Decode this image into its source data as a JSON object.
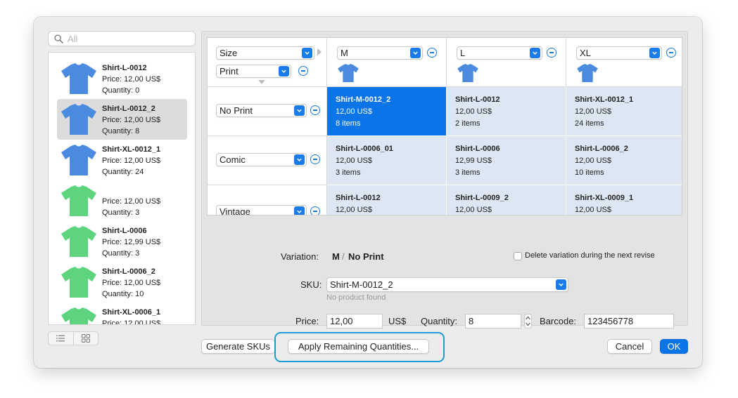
{
  "search": {
    "placeholder": "All"
  },
  "products": [
    {
      "name": "Shirt-L-0012",
      "price": "Price: 12,00 US$",
      "quantity": "Quantity: 0",
      "color": "#4a8be0"
    },
    {
      "name": "Shirt-L-0012_2",
      "price": "Price: 12,00 US$",
      "quantity": "Quantity: 8",
      "color": "#4a8be0",
      "selected": true
    },
    {
      "name": "Shirt-XL-0012_1",
      "price": "Price: 12,00 US$",
      "quantity": "Quantity: 24",
      "color": "#4a8be0"
    },
    {
      "name": "",
      "price": "Price: 12,00 US$",
      "quantity": "Quantity: 3",
      "color": "#5ed47e"
    },
    {
      "name": "Shirt-L-0006",
      "price": "Price: 12,99 US$",
      "quantity": "Quantity: 3",
      "color": "#5ed47e"
    },
    {
      "name": "Shirt-L-0006_2",
      "price": "Price: 12,00 US$",
      "quantity": "Quantity: 10",
      "color": "#5ed47e"
    },
    {
      "name": "Shirt-XL-0006_1",
      "price": "Price: 12,00 US$",
      "quantity": "",
      "color": "#5ed47e"
    }
  ],
  "grid": {
    "row_attribute": "Size",
    "col_attribute": "Print",
    "columns": [
      "M",
      "L",
      "XL"
    ],
    "rows": [
      "No Print",
      "Comic",
      "Vintage"
    ],
    "cells": [
      [
        {
          "sku": "Shirt-M-0012_2",
          "price": "12,00 US$",
          "items": "8 items",
          "active": true
        },
        {
          "sku": "Shirt-L-0012",
          "price": "12,00 US$",
          "items": "2 items"
        },
        {
          "sku": "Shirt-XL-0012_1",
          "price": "12,00 US$",
          "items": "24 items"
        }
      ],
      [
        {
          "sku": "Shirt-L-0006_01",
          "price": "12,00 US$",
          "items": "3 items"
        },
        {
          "sku": "Shirt-L-0006",
          "price": "12,99 US$",
          "items": "3 items"
        },
        {
          "sku": "Shirt-L-0006_2",
          "price": "12,00 US$",
          "items": "10 items"
        }
      ],
      [
        {
          "sku": "Shirt-L-0012",
          "price": "12,00 US$",
          "items": ""
        },
        {
          "sku": "Shirt-L-0009_2",
          "price": "12,00 US$",
          "items": ""
        },
        {
          "sku": "Shirt-XL-0009_1",
          "price": "12,00 US$",
          "items": ""
        }
      ]
    ]
  },
  "details": {
    "variation_label": "Variation:",
    "variation_size": "M",
    "variation_sep": "/",
    "variation_print": "No Print",
    "delete_checkbox_label": "Delete variation during the next revise",
    "sku_label": "SKU:",
    "sku_value": "Shirt-M-0012_2",
    "sku_hint": "No product found",
    "price_label": "Price:",
    "price_value": "12,00",
    "currency": "US$",
    "quantity_label": "Quantity:",
    "quantity_value": "8",
    "barcode_label": "Barcode:",
    "barcode_value": "123456778"
  },
  "footer": {
    "generate_label": "Generate SKUs",
    "apply_label": "Apply Remaining Quantities...",
    "cancel_label": "Cancel",
    "ok_label": "OK"
  },
  "colors": {
    "accent": "#0a74e8",
    "highlight_ring": "#1d9bd7",
    "cell_bg": "#dce7f3"
  }
}
